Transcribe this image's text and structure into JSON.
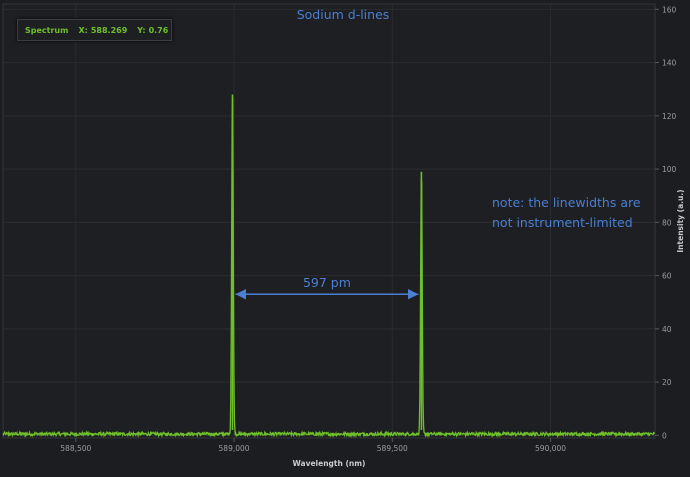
{
  "chart_data": {
    "type": "line",
    "title": "Sodium d-lines",
    "xlabel": "Wavelength (nm)",
    "ylabel": "Intensity (a.u.)",
    "xlim": [
      588.27,
      590.33
    ],
    "ylim": [
      -1,
      162
    ],
    "x_ticks": [
      "588,500",
      "589,000",
      "589,500",
      "590,000"
    ],
    "x_tick_values": [
      588.5,
      589.0,
      589.5,
      590.0
    ],
    "y_ticks": [
      "0",
      "20",
      "40",
      "60",
      "80",
      "100",
      "120",
      "140",
      "160"
    ],
    "y_tick_values": [
      0,
      20,
      40,
      60,
      80,
      100,
      120,
      140,
      160
    ],
    "grid": true,
    "series": [
      {
        "name": "Spectrum",
        "color": "#6fbf2a",
        "peaks": [
          {
            "x": 588.995,
            "height": 128
          },
          {
            "x": 589.592,
            "height": 99
          }
        ],
        "baseline": 0.5
      }
    ],
    "cursor_readout": {
      "series": "Spectrum",
      "x_label": "X:",
      "x_value": "588.269",
      "y_label": "Y:",
      "y_value": "0.76"
    },
    "annotations": [
      {
        "text": "597 pm",
        "from_x": 588.995,
        "to_x": 589.592,
        "y": 53
      },
      {
        "lines": [
          "note: the linewidths are",
          "not instrument-limited"
        ]
      }
    ],
    "colors": {
      "background": "#1c1d20",
      "grid": "#2a2c30",
      "series": "#6fbf2a",
      "annotation": "#4a7fd1"
    }
  }
}
